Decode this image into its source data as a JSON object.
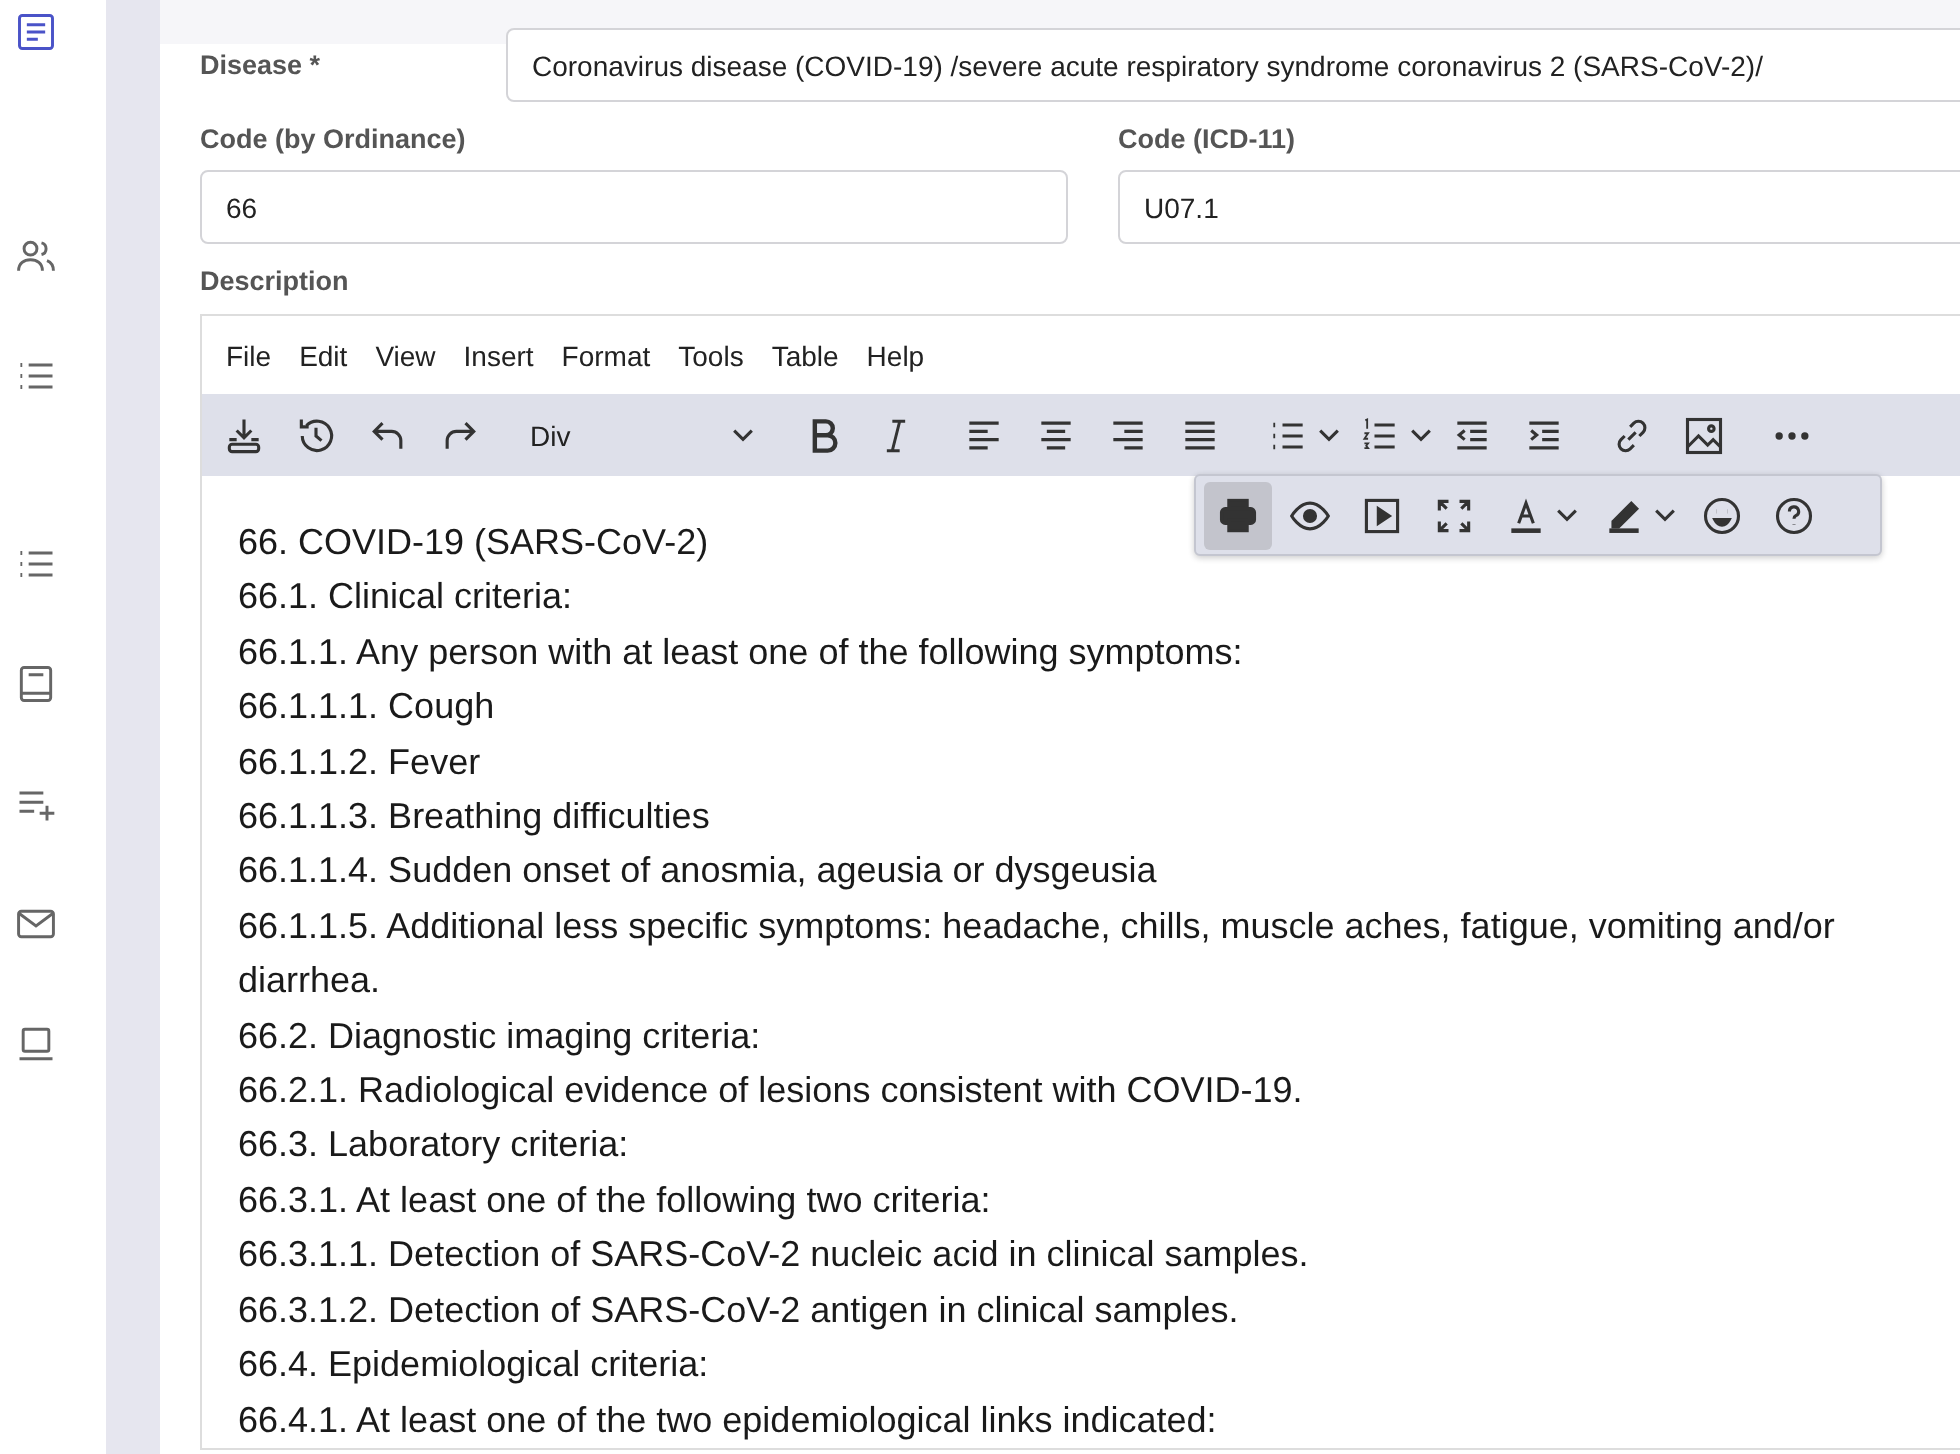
{
  "sidebar": {
    "items": [
      {
        "selected": true
      },
      {
        "selected": false
      },
      {
        "selected": false
      },
      {
        "selected": false
      },
      {
        "selected": false
      },
      {
        "selected": false
      },
      {
        "selected": false
      },
      {
        "selected": false
      }
    ]
  },
  "form": {
    "disease": {
      "label": "Disease *",
      "value": "Coronavirus disease (COVID-19) /severe acute respiratory syndrome coronavirus 2 (SARS-CoV-2)/"
    },
    "code_ordinance": {
      "label": "Code (by Ordinance)",
      "value": "66"
    },
    "code_icd": {
      "label": "Code (ICD-11)",
      "value": "U07.1"
    },
    "description_label": "Description"
  },
  "editor": {
    "menu": [
      "File",
      "Edit",
      "View",
      "Insert",
      "Format",
      "Tools",
      "Table",
      "Help"
    ],
    "block_format": "Div",
    "more_toolbar": [
      {
        "selected": true
      },
      {
        "selected": false
      },
      {
        "selected": false
      },
      {
        "selected": false
      },
      {
        "selected": false
      },
      {
        "selected": false
      },
      {
        "selected": false
      },
      {
        "selected": false
      }
    ],
    "lines": [
      "66. COVID-19 (SARS-CoV-2)",
      "66.1. Clinical criteria:",
      "66.1.1. Any person with at least one of the following symptoms:",
      "66.1.1.1. Cough",
      "66.1.1.2. Fever",
      "66.1.1.3. Breathing difficulties",
      "66.1.1.4. Sudden onset of anosmia, ageusia or dysgeusia",
      "66.1.1.5. Additional less specific symptoms: headache, chills, muscle aches, fatigue, vomiting and/or",
      "diarrhea.",
      "66.2. Diagnostic imaging criteria:",
      "66.2.1. Radiological evidence of lesions consistent with COVID-19.",
      "66.3. Laboratory criteria:",
      "66.3.1. At least one of the following two criteria:",
      "66.3.1.1. Detection of SARS-CoV-2 nucleic acid in clinical samples.",
      "66.3.1.2. Detection of SARS-CoV-2 antigen in clinical samples.",
      "66.4. Epidemiological criteria:",
      "66.4.1. At least one of the two epidemiological links indicated:"
    ]
  }
}
